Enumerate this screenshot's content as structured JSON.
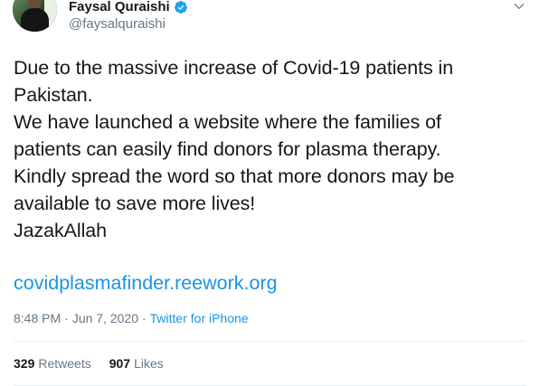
{
  "author": {
    "display_name": "Faysal Quraishi",
    "handle": "@faysalquraishi",
    "verified": true
  },
  "tweet": {
    "text": "Due to the massive increase of Covid-19 patients in\nPakistan.\nWe have launched a website where the families of\npatients can easily find donors for plasma therapy.\nKindly spread the word so that more donors may be\navailable to save more lives!\nJazakAllah",
    "link": "covidplasmafinder.reework.org",
    "time": "8:48 PM",
    "separator": "·",
    "date": "Jun 7, 2020",
    "source": "Twitter for iPhone"
  },
  "stats": {
    "retweets_count": "329",
    "retweets_label": "Retweets",
    "likes_count": "907",
    "likes_label": "Likes"
  },
  "colors": {
    "link": "#1b95e0",
    "muted": "#657786",
    "text": "#14171a",
    "divider": "#e6ecf0"
  },
  "icons": {
    "verified": "verified-badge-icon",
    "caret": "chevron-down-icon"
  }
}
